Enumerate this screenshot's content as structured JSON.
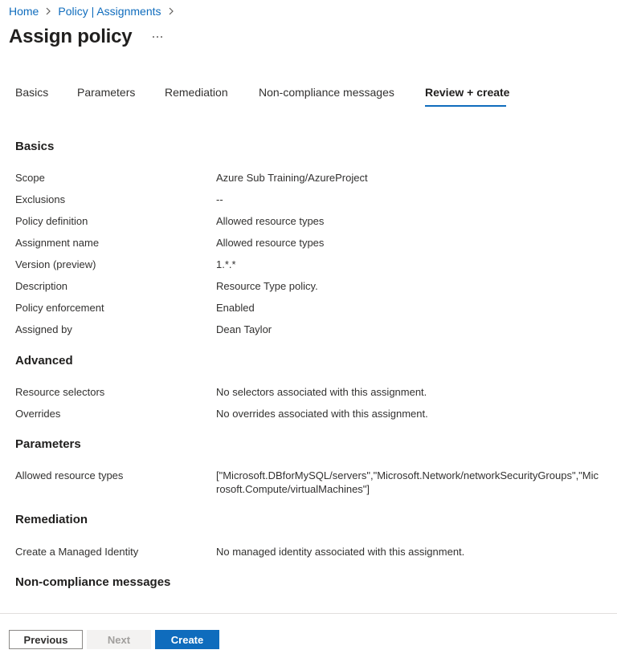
{
  "breadcrumb": {
    "items": [
      "Home",
      "Policy | Assignments"
    ]
  },
  "page": {
    "title": "Assign policy",
    "more_label": "···"
  },
  "tabs": [
    {
      "label": "Basics"
    },
    {
      "label": "Parameters"
    },
    {
      "label": "Remediation"
    },
    {
      "label": "Non-compliance messages"
    },
    {
      "label": "Review + create",
      "active": true
    }
  ],
  "basics": {
    "heading": "Basics",
    "rows": [
      {
        "label": "Scope",
        "value": "Azure Sub Training/AzureProject"
      },
      {
        "label": "Exclusions",
        "value": "--"
      },
      {
        "label": "Policy definition",
        "value": "Allowed resource types"
      },
      {
        "label": "Assignment name",
        "value": "Allowed resource types"
      },
      {
        "label": "Version (preview)",
        "value": "1.*.*"
      },
      {
        "label": "Description",
        "value": "Resource Type policy."
      },
      {
        "label": "Policy enforcement",
        "value": "Enabled"
      },
      {
        "label": "Assigned by",
        "value": "Dean Taylor"
      }
    ]
  },
  "advanced": {
    "heading": "Advanced",
    "rows": [
      {
        "label": "Resource selectors",
        "value": "No selectors associated with this assignment."
      },
      {
        "label": "Overrides",
        "value": "No overrides associated with this assignment."
      }
    ]
  },
  "parameters": {
    "heading": "Parameters",
    "rows": [
      {
        "label": "Allowed resource types",
        "value": "[\"Microsoft.DBforMySQL/servers\",\"Microsoft.Network/networkSecurityGroups\",\"Microsoft.Compute/virtualMachines\"]"
      }
    ]
  },
  "remediation": {
    "heading": "Remediation",
    "rows": [
      {
        "label": "Create a Managed Identity",
        "value": "No managed identity associated with this assignment."
      }
    ]
  },
  "noncompliance": {
    "heading": "Non-compliance messages"
  },
  "footer": {
    "previous_label": "Previous",
    "next_label": "Next",
    "create_label": "Create"
  },
  "colors": {
    "accent": "#0f6cbd",
    "disabled_bg": "#f3f2f1"
  },
  "icons": {
    "breadcrumb_separator": "chevron-right-icon",
    "more": "more-icon"
  }
}
